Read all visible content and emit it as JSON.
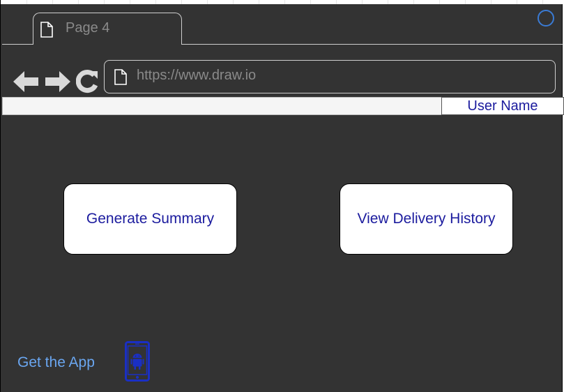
{
  "tab": {
    "label": "Page 4"
  },
  "browser": {
    "url": "https://www.draw.io"
  },
  "user": {
    "name": "User Name"
  },
  "actions": {
    "generate_summary": "Generate Summary",
    "view_delivery_history": "View Delivery History"
  },
  "footer": {
    "get_app": "Get the App"
  },
  "icons": {
    "tab": "page-icon",
    "back": "arrow-left-icon",
    "forward": "arrow-right-icon",
    "reload": "reload-icon",
    "url": "page-icon",
    "status": "circle-icon",
    "app": "android-phone-icon"
  },
  "colors": {
    "background": "#333333",
    "button_text": "#1b1b9e",
    "link": "#6aa6f0",
    "status_circle": "#3a7bd5"
  }
}
